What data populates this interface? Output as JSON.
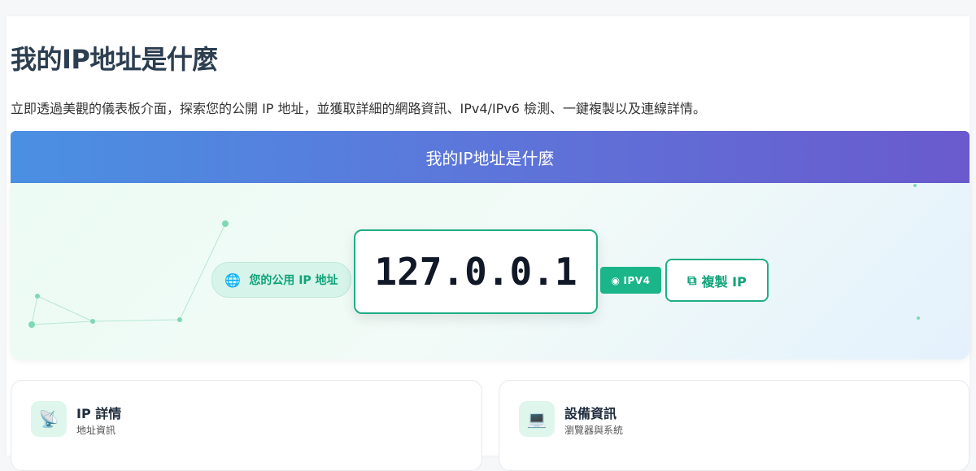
{
  "page": {
    "title": "我的IP地址是什麼",
    "description": "立即透過美觀的儀表板介面，探索您的公開 IP 地址，並獲取詳細的網路資訊、IPv4/IPv6 檢測、一鍵複製以及連線詳情。"
  },
  "banner": {
    "title": "我的IP地址是什麼"
  },
  "hero": {
    "label_icon": "🌐",
    "label_text": "您的公用 IP 地址",
    "ip_address": "127.0.0.1",
    "version_badge_icon": "◉",
    "version_badge": "IPV4",
    "copy_button_icon": "⧉",
    "copy_button_label": "複製 IP"
  },
  "cards": [
    {
      "icon": "📡",
      "title": "IP 詳情",
      "subtitle": "地址資訊"
    },
    {
      "icon": "💻",
      "title": "設備資訊",
      "subtitle": "瀏覽器與系統"
    }
  ],
  "colors": {
    "accent": "#1fae85",
    "banner_start": "#4a90e2",
    "banner_end": "#6a5acd"
  }
}
